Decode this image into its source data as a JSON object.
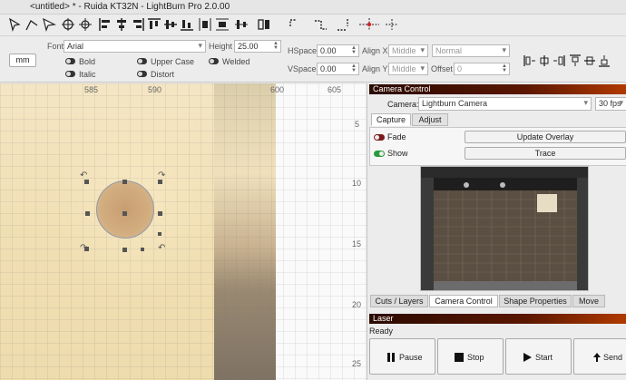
{
  "window": {
    "title": "<untitled> * - Ruida KT32N - LightBurn Pro 2.0.00"
  },
  "toolbar": {
    "icons": [
      "arrow-select-icon",
      "draw-lines-icon",
      "edit-nodes-icon",
      "target-icon",
      "crosshair-icon",
      "align-left-icon",
      "align-center-h-icon",
      "align-right-icon",
      "align-top-icon",
      "align-center-v-icon",
      "align-bottom-icon",
      "distribute-h-icon",
      "distribute-v-icon",
      "move-together-icon",
      "dock-icon",
      "nudge-left-icon",
      "nudge-right-icon",
      "nudge-up-icon",
      "nudge-down-icon",
      "position-laser-icon"
    ]
  },
  "textbar": {
    "unit_button": "mm",
    "font_label": "Font",
    "font_value": "Arial",
    "height_label": "Height",
    "height_value": "25.00",
    "hspace_label": "HSpace",
    "hspace_value": "0.00",
    "vspace_label": "VSpace",
    "vspace_value": "0.00",
    "align_x_label": "Align X",
    "align_x_value": "Middle",
    "align_y_label": "Align Y",
    "align_y_value": "Middle",
    "style_value": "Normal",
    "offset_label": "Offset",
    "offset_value": "0",
    "bold_label": "Bold",
    "italic_label": "Italic",
    "upper_case_label": "Upper Case",
    "distort_label": "Distort",
    "welded_label": "Welded"
  },
  "canvas": {
    "ruler_top": [
      "585",
      "590",
      "600",
      "605"
    ],
    "ruler_right": [
      "5",
      "10",
      "15",
      "20",
      "25"
    ]
  },
  "camera_panel": {
    "title": "Camera Control",
    "camera_label": "Camera:",
    "camera_value": "Lightburn Camera",
    "fps_value": "30 fps",
    "tabs": [
      "Capture",
      "Adjust"
    ],
    "fade_label": "Fade",
    "show_label": "Show",
    "update_overlay_button": "Update Overlay",
    "trace_button": "Trace"
  },
  "bottom_tabs": [
    "Cuts / Layers",
    "Camera Control",
    "Shape Properties",
    "Move"
  ],
  "laser_panel": {
    "title": "Laser",
    "status": "Ready",
    "pause_button": "Pause",
    "stop_button": "Stop",
    "start_button": "Start",
    "send_button": "Send"
  }
}
